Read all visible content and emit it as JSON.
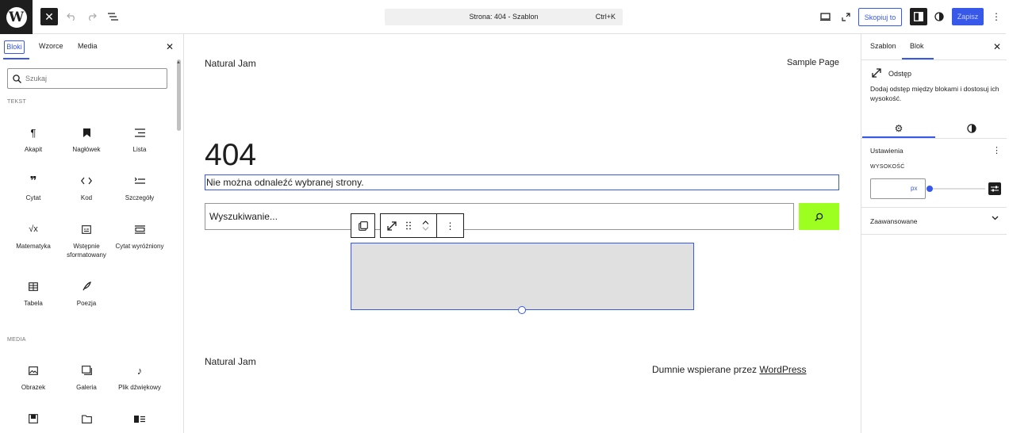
{
  "topbar": {
    "document_title": "Strona: 404 - Szablon",
    "command_shortcut": "Ctrl+K",
    "copy_label": "Skopiuj to",
    "save_label": "Zapisz"
  },
  "inserter": {
    "tabs": [
      {
        "label": "Bloki"
      },
      {
        "label": "Wzorce"
      },
      {
        "label": "Media"
      }
    ],
    "search_placeholder": "Szukaj",
    "sections": {
      "text": "TEKST",
      "media": "MEDIA"
    },
    "text_blocks": [
      {
        "label": "Akapit",
        "icon": "paragraph-icon"
      },
      {
        "label": "Nagłówek",
        "icon": "heading-icon"
      },
      {
        "label": "Lista",
        "icon": "list-icon"
      },
      {
        "label": "Cytat",
        "icon": "quote-icon"
      },
      {
        "label": "Kod",
        "icon": "code-icon"
      },
      {
        "label": "Szczegóły",
        "icon": "details-icon"
      },
      {
        "label": "Matematyka",
        "icon": "math-icon"
      },
      {
        "label": "Wstępnie sformatowany",
        "icon": "preformatted-icon"
      },
      {
        "label": "Cytat wyróżniony",
        "icon": "pullquote-icon"
      },
      {
        "label": "Tabela",
        "icon": "table-icon"
      },
      {
        "label": "Poezja",
        "icon": "verse-icon"
      }
    ],
    "media_blocks": [
      {
        "label": "Obrazek",
        "icon": "image-icon"
      },
      {
        "label": "Galeria",
        "icon": "gallery-icon"
      },
      {
        "label": "Plik dźwiękowy",
        "icon": "audio-icon"
      }
    ]
  },
  "canvas": {
    "site_title": "Natural Jam",
    "nav_link": "Sample Page",
    "heading": "404",
    "message": "Nie można odnaleźć wybranej strony.",
    "search_placeholder": "Wyszukiwanie...",
    "footer_title": "Natural Jam",
    "footer_credit_prefix": "Dumnie wspierane przez ",
    "footer_credit_link": "WordPress",
    "accent_color": "#9dff20"
  },
  "sidebar": {
    "tabs": [
      {
        "label": "Szablon"
      },
      {
        "label": "Blok"
      }
    ],
    "block_title": "Odstęp",
    "block_description": "Dodaj odstęp między blokami i dostosuj ich wysokość.",
    "settings_title": "Ustawienia",
    "height_label": "WYSOKOŚĆ",
    "height_unit": "px",
    "advanced_title": "Zaawansowane"
  },
  "colors": {
    "admin_accent": "#3858e9",
    "dark": "#1e1e1e"
  }
}
